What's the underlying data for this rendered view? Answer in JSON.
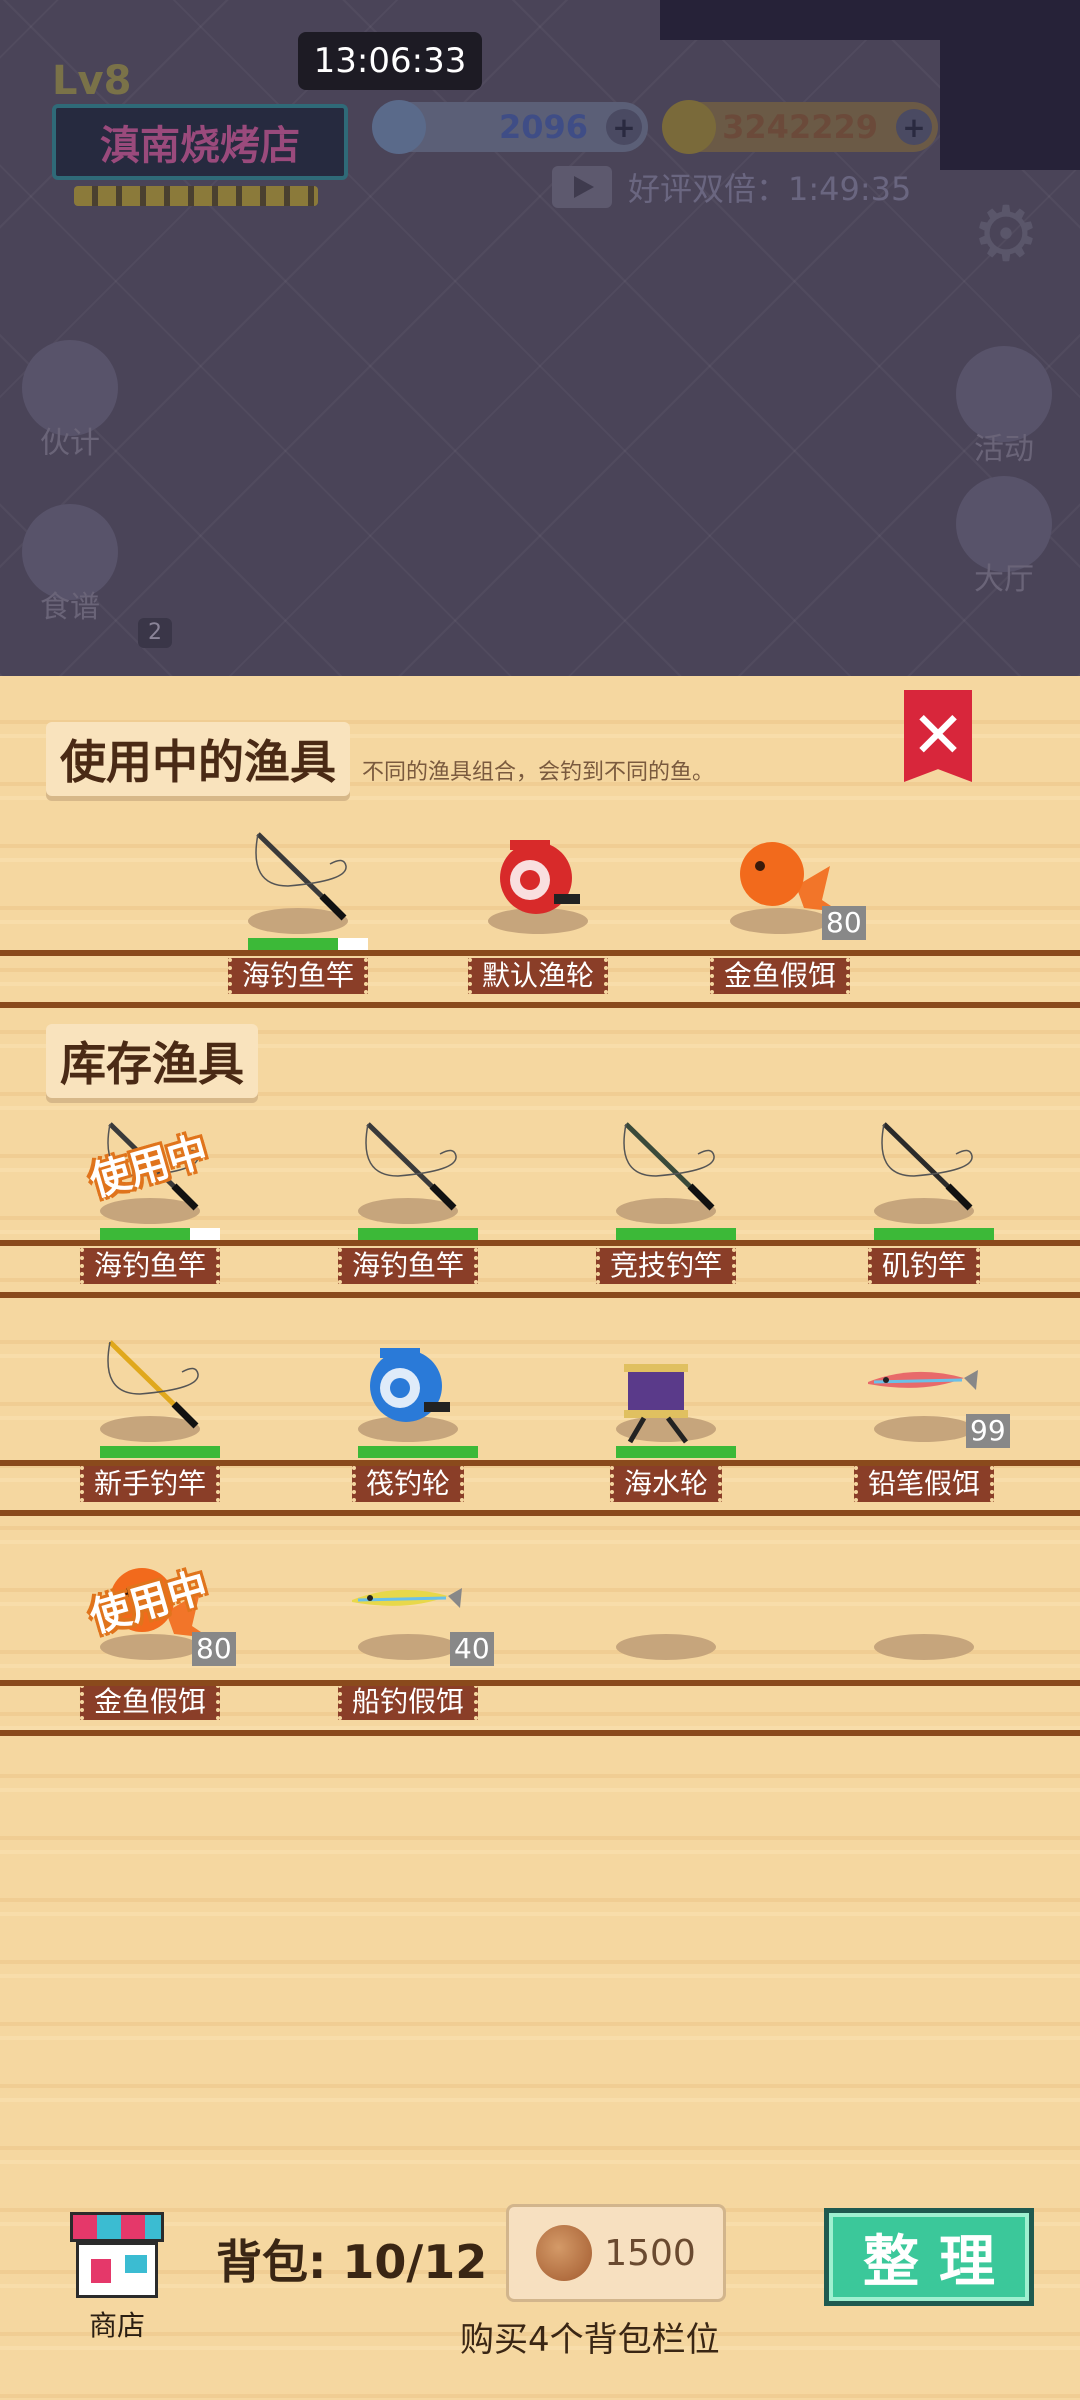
{
  "status_bar": {
    "time": "13:06:33"
  },
  "background": {
    "level": "Lv8",
    "shop_name": "滇南烧烤店",
    "diamonds": "2096",
    "gold": "3242229",
    "bonus_text": "好评双倍：1:49:35",
    "left_menu": [
      {
        "label": "伙计"
      },
      {
        "label": "食谱"
      }
    ],
    "right_menu": [
      {
        "label": "活动"
      },
      {
        "label": "大厅"
      }
    ],
    "badge": "2"
  },
  "panel": {
    "equipped_title": "使用中的渔具",
    "equipped_hint": "不同的渔具组合，会钓到不同的鱼。",
    "equipped": [
      {
        "name": "海钓鱼竿",
        "type": "rod",
        "color": "#3a3a3a",
        "durability": 0.75
      },
      {
        "name": "默认渔轮",
        "type": "reel",
        "color": "#d82a2a"
      },
      {
        "name": "金鱼假饵",
        "type": "goldfish",
        "color": "#f26a1c",
        "count": "80"
      }
    ],
    "inventory_title": "库存渔具",
    "in_use_label": "使用中",
    "inventory": [
      {
        "name": "海钓鱼竿",
        "type": "rod",
        "color": "#3a3a3a",
        "durability": 0.75,
        "in_use": true
      },
      {
        "name": "海钓鱼竿",
        "type": "rod",
        "color": "#3a3a3a",
        "durability": 1
      },
      {
        "name": "竞技钓竿",
        "type": "rod",
        "color": "#3a4a3a",
        "durability": 1
      },
      {
        "name": "矶钓竿",
        "type": "rod",
        "color": "#2a2a2a",
        "durability": 1
      },
      {
        "name": "新手钓竿",
        "type": "rod",
        "color": "#e0a81c",
        "durability": 1
      },
      {
        "name": "筏钓轮",
        "type": "reel",
        "color": "#2a7ad8",
        "durability": 1
      },
      {
        "name": "海水轮",
        "type": "spool",
        "color": "#5a3a8a",
        "durability": 1
      },
      {
        "name": "铅笔假饵",
        "type": "lure",
        "color": "#e86a6a",
        "count": "99"
      },
      {
        "name": "金鱼假饵",
        "type": "goldfish",
        "color": "#f26a1c",
        "count": "80",
        "in_use": true
      },
      {
        "name": "船钓假饵",
        "type": "lure",
        "color": "#e8d84a",
        "count": "40"
      },
      {
        "name": "",
        "type": "empty"
      },
      {
        "name": "",
        "type": "empty"
      }
    ]
  },
  "footer": {
    "store_label": "商店",
    "bag_text": "背包: 10/12",
    "buy_price": "1500",
    "tidy_label": "整理",
    "buy_hint": "购买4个背包栏位"
  }
}
